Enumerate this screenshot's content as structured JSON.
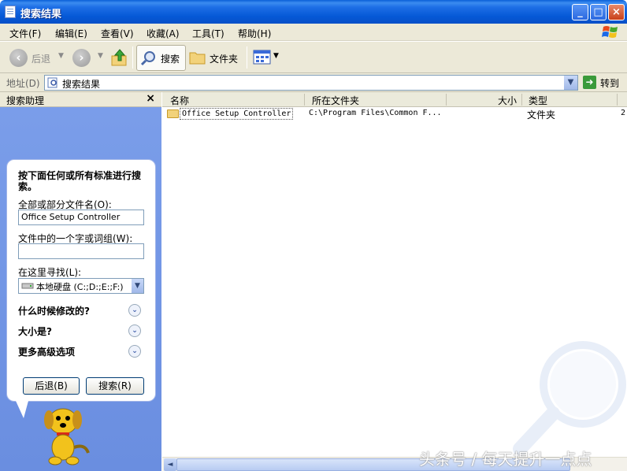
{
  "window": {
    "title": "搜索结果",
    "minimize": "_",
    "maximize": "□",
    "close": "×"
  },
  "menu": [
    "文件(F)",
    "编辑(E)",
    "查看(V)",
    "收藏(A)",
    "工具(T)",
    "帮助(H)"
  ],
  "toolbar": {
    "back_label": "后退",
    "search_label": "搜索",
    "folders_label": "文件夹"
  },
  "address": {
    "label": "地址(D)",
    "value": "搜索结果",
    "go_label": "转到"
  },
  "pane": {
    "title": "搜索助理",
    "close": "×",
    "heading": "按下面任何或所有标准进行搜索。",
    "filename_label": "全部或部分文件名(O):",
    "filename_value": "Office Setup Controller",
    "word_label": "文件中的一个字或词组(W):",
    "word_value": "",
    "lookin_label": "在这里寻找(L):",
    "lookin_value": "本地硬盘 (C:;D:;E:;F:)",
    "when_modified": "什么时候修改的?",
    "size": "大小是?",
    "advanced": "更多高级选项",
    "back_button": "后退(B)",
    "search_button": "搜索(R)"
  },
  "columns": [
    "名称",
    "所在文件夹",
    "大小",
    "类型"
  ],
  "results": [
    {
      "name": "Office Setup Controller",
      "folder": "C:\\Program Files\\Common F...",
      "size": "",
      "type": "文件夹",
      "extra": "2"
    }
  ],
  "watermark": "头条号 / 每天提升一点点"
}
